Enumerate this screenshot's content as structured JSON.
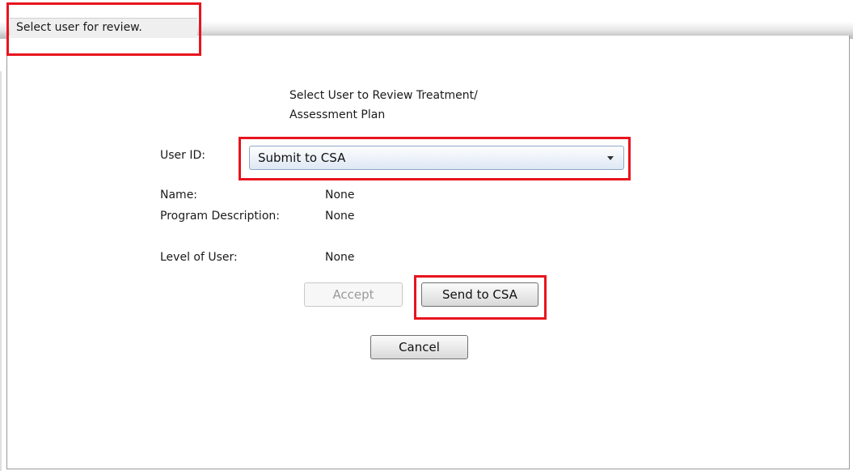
{
  "window": {
    "title": "Select user for review."
  },
  "dialog": {
    "heading_line1": "Select User to Review Treatment/",
    "heading_line2": "Assessment Plan",
    "user_id_label": "User ID:",
    "user_id_selected": "Submit to CSA",
    "fields": {
      "name_label": "Name:",
      "name_value": "None",
      "program_description_label": "Program Description:",
      "program_description_value": "None",
      "level_of_user_label": "Level of User:",
      "level_of_user_value": "None"
    },
    "buttons": {
      "accept": "Accept",
      "send_to_csa": "Send to CSA",
      "cancel": "Cancel"
    }
  },
  "colors": {
    "highlight": "#e8141e",
    "disabled_text": "#9a9a9a",
    "dropdown_border": "#8fa8c8"
  },
  "icons": {
    "dropdown_arrow": "chevron-down-icon"
  },
  "states": {
    "accept_enabled": false
  }
}
